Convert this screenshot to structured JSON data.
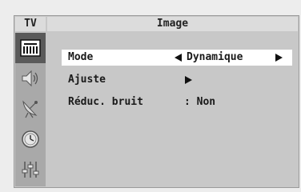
{
  "header": {
    "tv_label": "TV",
    "title": "Image"
  },
  "sidebar": {
    "items": [
      {
        "icon": "picture-icon",
        "active": true
      },
      {
        "icon": "speaker-icon",
        "active": false
      },
      {
        "icon": "satellite-dish-icon",
        "active": false
      },
      {
        "icon": "clock-icon",
        "active": false
      },
      {
        "icon": "equalizer-icon",
        "active": false
      }
    ]
  },
  "menu": {
    "mode": {
      "label": "Mode",
      "value": "Dynamique"
    },
    "ajuste": {
      "label": "Ajuste"
    },
    "noise": {
      "label": "Réduc. bruit",
      "value": ": Non"
    }
  },
  "colors": {
    "frame": "#c8c8c8",
    "header": "#dcdcdc",
    "sidebar": "#a9a9a9",
    "selected_row": "#ffffff"
  }
}
